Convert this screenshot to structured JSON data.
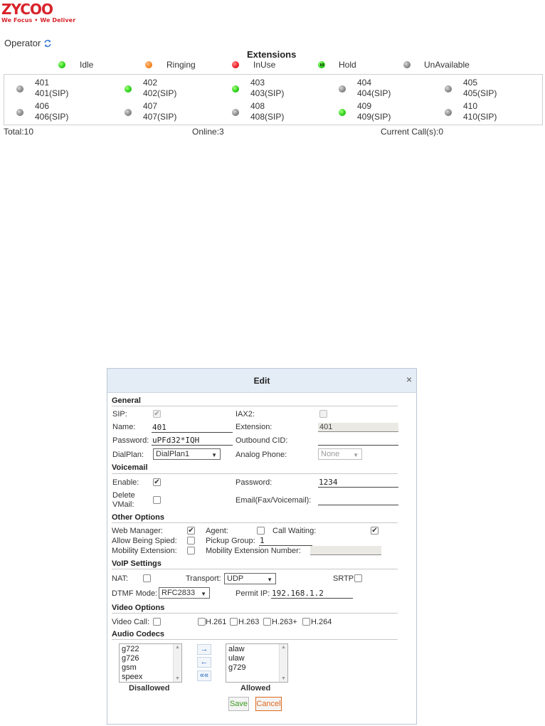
{
  "brand": {
    "logo_text": "ZYCOO",
    "tagline": "We Focus • We Deliver"
  },
  "operator": {
    "label": "Operator",
    "refresh_icon": "refresh-icon"
  },
  "extensions": {
    "title": "Extensions",
    "legend": [
      {
        "label": "Idle",
        "status": "idle",
        "color": "#2fd41d"
      },
      {
        "label": "Ringing",
        "status": "ringing",
        "color": "#f58a25"
      },
      {
        "label": "InUse",
        "status": "inuse",
        "color": "#f0262c"
      },
      {
        "label": "Hold",
        "status": "hold",
        "color": "#2fd41d"
      },
      {
        "label": "UnAvailable",
        "status": "unavailable",
        "color": "#8d8d8d"
      }
    ],
    "items": [
      {
        "number": "401",
        "type": "401(SIP)",
        "status": "unavailable"
      },
      {
        "number": "402",
        "type": "402(SIP)",
        "status": "idle"
      },
      {
        "number": "403",
        "type": "403(SIP)",
        "status": "idle"
      },
      {
        "number": "404",
        "type": "404(SIP)",
        "status": "unavailable"
      },
      {
        "number": "405",
        "type": "405(SIP)",
        "status": "unavailable"
      },
      {
        "number": "406",
        "type": "406(SIP)",
        "status": "unavailable"
      },
      {
        "number": "407",
        "type": "407(SIP)",
        "status": "unavailable"
      },
      {
        "number": "408",
        "type": "408(SIP)",
        "status": "unavailable"
      },
      {
        "number": "409",
        "type": "409(SIP)",
        "status": "idle"
      },
      {
        "number": "410",
        "type": "410(SIP)",
        "status": "unavailable"
      }
    ],
    "stats": {
      "total": "Total:10",
      "online": "Online:3",
      "current_calls": "Current Call(s):0"
    }
  },
  "dialog": {
    "title": "Edit",
    "close": "×",
    "general": {
      "heading": "General",
      "sip_label": "SIP:",
      "sip_checked": true,
      "iax2_label": "IAX2:",
      "iax2_checked": false,
      "name_label": "Name:",
      "name_value": "401",
      "extension_label": "Extension:",
      "extension_value": "401",
      "password_label": "Password:",
      "password_value": "uPFd32*IQH",
      "outbound_cid_label": "Outbound CID:",
      "outbound_cid_value": "",
      "dialplan_label": "DialPlan:",
      "dialplan_value": "DialPlan1",
      "analog_phone_label": "Analog Phone:",
      "analog_phone_value": "None"
    },
    "voicemail": {
      "heading": "Voicemail",
      "enable_label": "Enable:",
      "enable_checked": true,
      "password_label": "Password:",
      "password_value": "1234",
      "delete_label_1": "Delete",
      "delete_label_2": "VMail:",
      "delete_checked": false,
      "email_label": "Email(Fax/Voicemail):",
      "email_value": ""
    },
    "other": {
      "heading": "Other Options",
      "web_manager_label": "Web Manager:",
      "web_manager_checked": true,
      "agent_label": "Agent:",
      "agent_checked": false,
      "call_waiting_label": "Call Waiting:",
      "call_waiting_checked": true,
      "allow_spied_label": "Allow Being Spied:",
      "allow_spied_checked": false,
      "pickup_group_label": "Pickup Group:",
      "pickup_group_value": "1",
      "mobility_ext_label": "Mobility Extension:",
      "mobility_ext_checked": false,
      "mobility_number_label": "Mobility Extension Number:",
      "mobility_number_value": ""
    },
    "voip": {
      "heading": "VoIP Settings",
      "nat_label": "NAT:",
      "nat_checked": false,
      "transport_label": "Transport:",
      "transport_value": "UDP",
      "srtp_label": "SRTP:",
      "srtp_checked": false,
      "dtmf_label": "DTMF Mode:",
      "dtmf_value": "RFC2833",
      "permit_ip_label": "Permit IP:",
      "permit_ip_value": "192.168.1.2"
    },
    "video": {
      "heading": "Video Options",
      "video_call_label": "Video Call:",
      "video_call_checked": false,
      "codecs": [
        "H.261",
        "H.263",
        "H.263+",
        "H.264"
      ]
    },
    "audio": {
      "heading": "Audio Codecs",
      "disallowed": [
        "g722",
        "g726",
        "gsm",
        "speex"
      ],
      "allowed": [
        "alaw",
        "ulaw",
        "g729"
      ],
      "disallowed_label": "Disallowed",
      "allowed_label": "Allowed",
      "move_right": "→",
      "move_left": "←",
      "move_all_left": "««"
    },
    "save_label": "Save",
    "cancel_label": "Cancel",
    "save_color": "#3c9a1f",
    "cancel_color": "#e06a1e"
  }
}
